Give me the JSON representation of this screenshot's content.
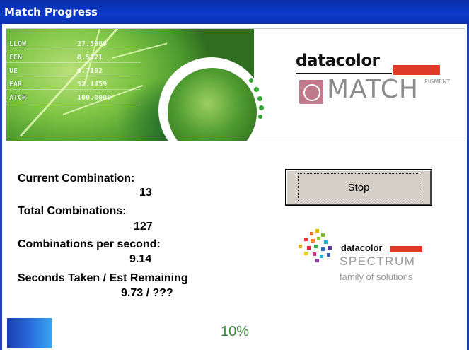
{
  "window": {
    "title": "Match Progress"
  },
  "banner": {
    "readouts": [
      {
        "label": "LLOW",
        "value": "27.5989"
      },
      {
        "label": "EEN",
        "value": "8.5321"
      },
      {
        "label": "UE",
        "value": "6.7192"
      },
      {
        "label": "EAR",
        "value": "52.1459"
      },
      {
        "label": "ATCH",
        "value": "100.0000"
      }
    ],
    "logo_wordmark": "datacolor",
    "logo_product": "MATCH",
    "logo_product_suffix": "PIGMENT"
  },
  "stats": {
    "current_combination_label": "Current Combination:",
    "current_combination_value": "13",
    "total_combinations_label": "Total Combinations:",
    "total_combinations_value": "127",
    "combinations_per_second_label": "Combinations per second:",
    "combinations_per_second_value": "9.14",
    "seconds_label": "Seconds Taken / Est Remaining",
    "seconds_value": "9.73 / ???"
  },
  "actions": {
    "stop_label": "Stop"
  },
  "spectrum_logo": {
    "wordmark": "datacolor",
    "name": "SPECTRUM",
    "tagline": "family of solutions"
  },
  "progress": {
    "fraction": 0.1,
    "text": "10%"
  },
  "colors": {
    "title_bar": "#0b39c9",
    "brand_red": "#e03a2a",
    "progress_text": "#3c8c3c"
  }
}
